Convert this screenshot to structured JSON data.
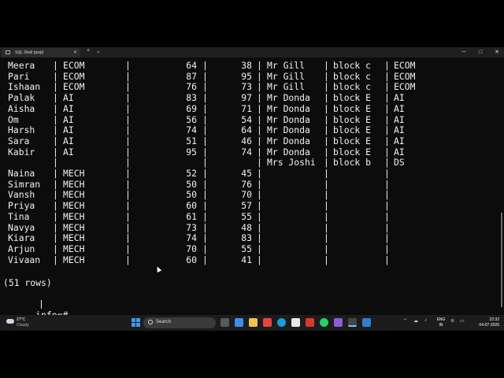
{
  "window": {
    "tab_title": "SQL Shell (psql)",
    "tab_close": "✕",
    "new_tab": "+",
    "dropdown": "⌄",
    "minimize": "─",
    "maximize": "□",
    "close": "✕"
  },
  "table": {
    "rows": [
      [
        "Meera",
        "ECOM",
        "64",
        "38",
        "Mr Gill",
        "block c",
        "ECOM"
      ],
      [
        "Pari",
        "ECOM",
        "87",
        "95",
        "Mr Gill",
        "block c",
        "ECOM"
      ],
      [
        "Ishaan",
        "ECOM",
        "76",
        "73",
        "Mr Gill",
        "block c",
        "ECOM"
      ],
      [
        "Palak",
        "AI",
        "83",
        "97",
        "Mr Donda",
        "block E",
        "AI"
      ],
      [
        "Aisha",
        "AI",
        "69",
        "71",
        "Mr Donda",
        "block E",
        "AI"
      ],
      [
        "Om",
        "AI",
        "56",
        "54",
        "Mr Donda",
        "block E",
        "AI"
      ],
      [
        "Harsh",
        "AI",
        "74",
        "64",
        "Mr Donda",
        "block E",
        "AI"
      ],
      [
        "Sara",
        "AI",
        "51",
        "46",
        "Mr Donda",
        "block E",
        "AI"
      ],
      [
        "Kabir",
        "AI",
        "95",
        "74",
        "Mr Donda",
        "block E",
        "AI"
      ],
      [
        "",
        "",
        "",
        "",
        "Mrs Joshi",
        "block b",
        "DS"
      ],
      [
        "Naina",
        "MECH",
        "52",
        "45",
        "",
        "",
        ""
      ],
      [
        "Simran",
        "MECH",
        "50",
        "76",
        "",
        "",
        ""
      ],
      [
        "Vansh",
        "MECH",
        "50",
        "70",
        "",
        "",
        ""
      ],
      [
        "Priya",
        "MECH",
        "60",
        "57",
        "",
        "",
        ""
      ],
      [
        "Tina",
        "MECH",
        "61",
        "55",
        "",
        "",
        ""
      ],
      [
        "Navya",
        "MECH",
        "73",
        "48",
        "",
        "",
        ""
      ],
      [
        "Kiara",
        "MECH",
        "74",
        "83",
        "",
        "",
        ""
      ],
      [
        "Arjun",
        "MECH",
        "70",
        "55",
        "",
        "",
        ""
      ],
      [
        "Vivaan",
        "MECH",
        "60",
        "41",
        "",
        "",
        ""
      ]
    ],
    "row_count": "(51 rows)"
  },
  "prompt": "info=#",
  "taskbar": {
    "weather_temp": "27°C",
    "weather_desc": "Cloudy",
    "search_label": "Search",
    "lang": "ENG",
    "region": "IN",
    "time": "22:32",
    "date": "04-07-2026"
  },
  "colors": {
    "terminal_bg": "#0c0c0c",
    "terminal_fg": "#f2f2f2",
    "taskbar_bg": "#1c1c1c"
  }
}
